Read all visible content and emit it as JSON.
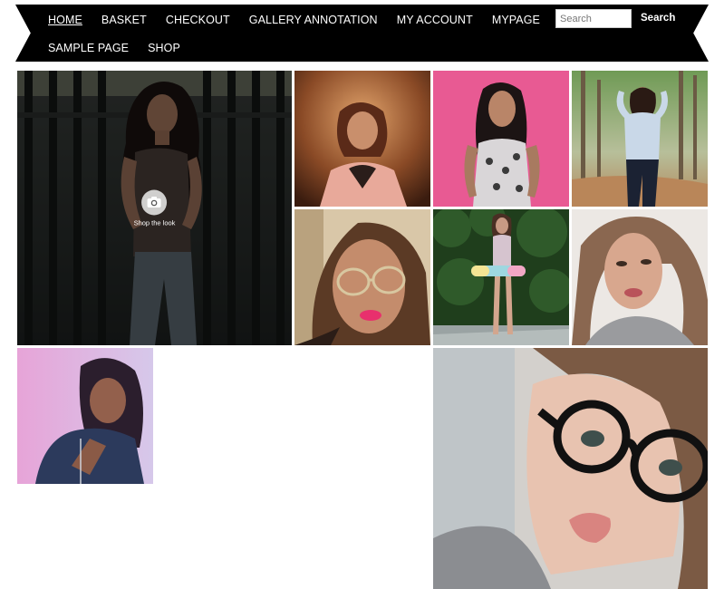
{
  "nav": {
    "row1": [
      "HOME",
      "BASKET",
      "CHECKOUT",
      "GALLERY ANNOTATION",
      "MY ACCOUNT",
      "MYPAGE"
    ],
    "row2": [
      "SAMPLE PAGE",
      "SHOP"
    ],
    "search_placeholder": "Search",
    "search_button": "Search"
  },
  "gallery": {
    "shop_the_look": "Shop the look",
    "tiles": [
      {
        "name": "woman-at-dark-gate-photo"
      },
      {
        "name": "woman-pink-blazer-portrait-photo"
      },
      {
        "name": "woman-pink-background-photo"
      },
      {
        "name": "woman-forest-path-photo"
      },
      {
        "name": "woman-glasses-selfie-photo"
      },
      {
        "name": "woman-skateboard-photo"
      },
      {
        "name": "woman-long-hair-selfie-photo"
      },
      {
        "name": "woman-denim-jacket-photo"
      },
      {
        "name": "woman-black-glasses-closeup-photo"
      }
    ]
  },
  "colors": {
    "nav_bg": "#000000",
    "nav_text": "#ffffff",
    "page_bg": "#ffffff"
  }
}
